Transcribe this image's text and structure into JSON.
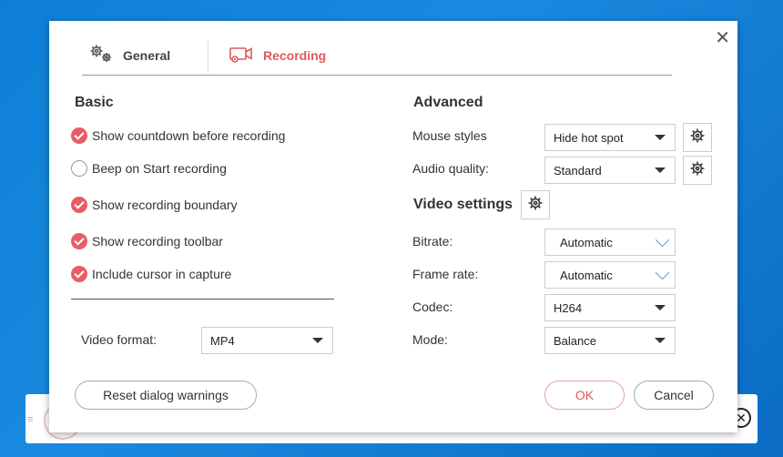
{
  "dialog": {
    "close_glyph": "✕",
    "tabs": [
      {
        "label": "General",
        "icon": "gears-icon",
        "active": false
      },
      {
        "label": "Recording",
        "icon": "camera-icon",
        "active": true
      }
    ],
    "basic": {
      "title": "Basic",
      "options": [
        {
          "label": "Show countdown before recording",
          "checked": true
        },
        {
          "label": "Beep on Start recording",
          "checked": false
        },
        {
          "label": "Show recording boundary",
          "checked": true
        },
        {
          "label": "Show recording toolbar",
          "checked": true
        },
        {
          "label": "Include cursor in capture",
          "checked": true
        }
      ],
      "video_format": {
        "label": "Video format:",
        "value": "MP4"
      }
    },
    "advanced": {
      "title": "Advanced",
      "mouse_styles": {
        "label": "Mouse styles",
        "value": "Hide hot spot"
      },
      "audio_quality": {
        "label": "Audio quality:",
        "value": "Standard"
      }
    },
    "video_settings": {
      "title": "Video settings",
      "bitrate": {
        "label": "Bitrate:",
        "value": "Automatic"
      },
      "frame_rate": {
        "label": "Frame rate:",
        "value": "Automatic"
      },
      "codec": {
        "label": "Codec:",
        "value": "H264"
      },
      "mode": {
        "label": "Mode:",
        "value": "Balance"
      }
    },
    "buttons": {
      "reset": "Reset dialog warnings",
      "ok": "OK",
      "cancel": "Cancel"
    }
  },
  "background_bar": {
    "grip": "≡",
    "close_glyph": "✕"
  },
  "colors": {
    "accent": "#e05a5a",
    "check": "#e85c66",
    "desktop": "#1a8ae0"
  }
}
